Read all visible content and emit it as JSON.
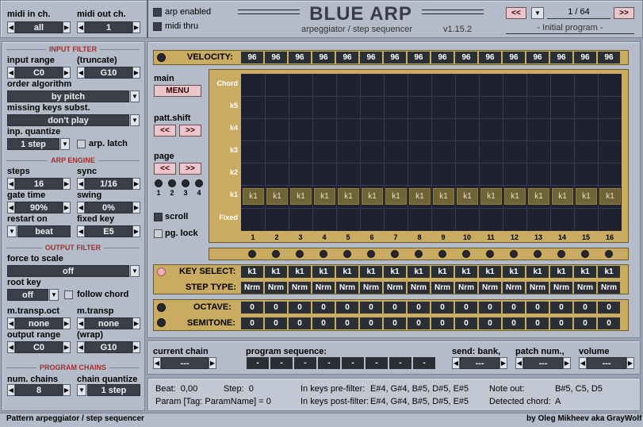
{
  "top": {
    "midi_in_label": "midi in ch.",
    "midi_in_value": "all",
    "midi_out_label": "midi out ch.",
    "midi_out_value": "1",
    "arp_enabled": "arp enabled",
    "midi_thru": "midi thru",
    "title": "BLUE ARP",
    "subtitle": "arpeggiator / step sequencer",
    "version": "v1.15.2",
    "program_counter": "1 / 64",
    "program_name": "- Initial program -"
  },
  "input_filter": {
    "header": "INPUT FILTER",
    "input_range_label": "input range",
    "input_range_low": "C0",
    "truncate_label": "(truncate)",
    "input_range_high": "G10",
    "order_label": "order algorithm",
    "order_value": "by pitch",
    "missing_label": "missing keys subst.",
    "missing_value": "don't play",
    "quantize_label": "inp. quantize",
    "quantize_value": "1 step",
    "latch_label": "arp. latch"
  },
  "arp_engine": {
    "header": "ARP ENGINE",
    "steps_label": "steps",
    "steps_value": "16",
    "sync_label": "sync",
    "sync_value": "1/16",
    "gate_label": "gate time",
    "gate_value": "90%",
    "swing_label": "swing",
    "swing_value": "0%",
    "restart_label": "restart on",
    "restart_value": "beat",
    "fixed_label": "fixed key",
    "fixed_value": "E5"
  },
  "output_filter": {
    "header": "OUTPUT FILTER",
    "force_label": "force to scale",
    "force_value": "off",
    "root_label": "root key",
    "root_value": "off",
    "follow_label": "follow chord",
    "mtransp_oct_label": "m.transp.oct",
    "mtransp_oct_value": "none",
    "mtransp_label": "m.transp",
    "mtransp_value": "none",
    "outrange_label": "output range",
    "outrange_low": "C0",
    "wrap_label": "(wrap)",
    "outrange_high": "G10"
  },
  "program_chains": {
    "header": "PROGRAM CHAINS",
    "num_label": "num. chains",
    "num_value": "8",
    "quant_label": "chain quantize",
    "quant_value": "1 step"
  },
  "velocity": {
    "label": "VELOCITY:",
    "values": [
      "96",
      "96",
      "96",
      "96",
      "96",
      "96",
      "96",
      "96",
      "96",
      "96",
      "96",
      "96",
      "96",
      "96",
      "96",
      "96"
    ]
  },
  "side": {
    "main_label": "main",
    "menu": "MENU",
    "patt_shift": "patt.shift",
    "left": "<<",
    "right": ">>",
    "page_label": "page",
    "pages": [
      "1",
      "2",
      "3",
      "4"
    ],
    "scroll": "scroll",
    "pg_lock": "pg. lock"
  },
  "grid": {
    "rows": [
      "Chord",
      "k5",
      "k4",
      "k3",
      "k2",
      "k1",
      "Fixed"
    ],
    "cell": "k1",
    "steps": [
      "1",
      "2",
      "3",
      "4",
      "5",
      "6",
      "7",
      "8",
      "9",
      "10",
      "11",
      "12",
      "13",
      "14",
      "15",
      "16"
    ]
  },
  "key_select": {
    "label": "KEY SELECT:",
    "values": [
      "k1",
      "k1",
      "k1",
      "k1",
      "k1",
      "k1",
      "k1",
      "k1",
      "k1",
      "k1",
      "k1",
      "k1",
      "k1",
      "k1",
      "k1",
      "k1"
    ]
  },
  "step_type": {
    "label": "STEP TYPE:",
    "values": [
      "Nrm",
      "Nrm",
      "Nrm",
      "Nrm",
      "Nrm",
      "Nrm",
      "Nrm",
      "Nrm",
      "Nrm",
      "Nrm",
      "Nrm",
      "Nrm",
      "Nrm",
      "Nrm",
      "Nrm",
      "Nrm"
    ]
  },
  "octave": {
    "label": "OCTAVE:",
    "values": [
      "0",
      "0",
      "0",
      "0",
      "0",
      "0",
      "0",
      "0",
      "0",
      "0",
      "0",
      "0",
      "0",
      "0",
      "0",
      "0"
    ]
  },
  "semitone": {
    "label": "SEMITONE:",
    "values": [
      "0",
      "0",
      "0",
      "0",
      "0",
      "0",
      "0",
      "0",
      "0",
      "0",
      "0",
      "0",
      "0",
      "0",
      "0",
      "0"
    ]
  },
  "chain": {
    "current_label": "current chain",
    "current_value": "---",
    "seq_label": "program sequence:",
    "seq_values": [
      "-",
      "-",
      "-",
      "-",
      "-",
      "-",
      "-",
      "-"
    ],
    "bank_label": "send: bank,",
    "bank_value": "---",
    "patch_label": "patch num.,",
    "patch_value": "---",
    "volume_label": "volume",
    "volume_value": "---"
  },
  "status": {
    "beat": "Beat:  0,00",
    "step": "Step:  0",
    "param": "Param [Tag: ParamName] = 0",
    "pre_label": "In keys pre-filter:",
    "pre_value": "E#4, G#4, B#5, D#5, E#5",
    "post_label": "In keys post-filter:",
    "post_value": "E#4, G#4, B#5, D#5, E#5",
    "note_out_label": "Note out:",
    "note_out_value": "B#5, C5, D5",
    "chord_label": "Detected chord:",
    "chord_value": "A"
  },
  "footer": {
    "left": "Pattern arpeggiator / step sequencer",
    "right": "by Oleg Mikheev aka GrayWolf"
  }
}
